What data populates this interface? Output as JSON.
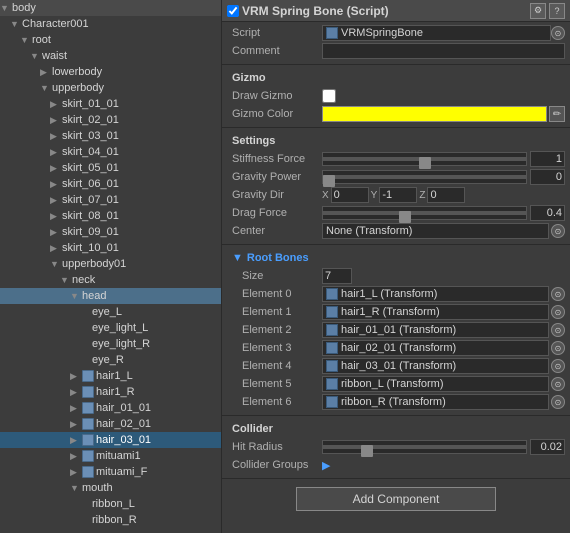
{
  "leftPanel": {
    "items": [
      {
        "id": "body",
        "label": "body",
        "indent": 0,
        "arrow": "down",
        "hasIcon": false
      },
      {
        "id": "character001",
        "label": "Character001",
        "indent": 1,
        "arrow": "down",
        "hasIcon": false
      },
      {
        "id": "root",
        "label": "root",
        "indent": 2,
        "arrow": "down",
        "hasIcon": false
      },
      {
        "id": "waist",
        "label": "waist",
        "indent": 3,
        "arrow": "down",
        "hasIcon": false
      },
      {
        "id": "lowerbody",
        "label": "lowerbody",
        "indent": 4,
        "arrow": "right",
        "hasIcon": false
      },
      {
        "id": "upperbody",
        "label": "upperbody",
        "indent": 4,
        "arrow": "down",
        "hasIcon": false
      },
      {
        "id": "skirt_01_01",
        "label": "skirt_01_01",
        "indent": 5,
        "arrow": "right",
        "hasIcon": false
      },
      {
        "id": "skirt_02_01",
        "label": "skirt_02_01",
        "indent": 5,
        "arrow": "right",
        "hasIcon": false
      },
      {
        "id": "skirt_03_01",
        "label": "skirt_03_01",
        "indent": 5,
        "arrow": "right",
        "hasIcon": false
      },
      {
        "id": "skirt_04_01",
        "label": "skirt_04_01",
        "indent": 5,
        "arrow": "right",
        "hasIcon": false
      },
      {
        "id": "skirt_05_01",
        "label": "skirt_05_01",
        "indent": 5,
        "arrow": "right",
        "hasIcon": false
      },
      {
        "id": "skirt_06_01",
        "label": "skirt_06_01",
        "indent": 5,
        "arrow": "right",
        "hasIcon": false
      },
      {
        "id": "skirt_07_01",
        "label": "skirt_07_01",
        "indent": 5,
        "arrow": "right",
        "hasIcon": false
      },
      {
        "id": "skirt_08_01",
        "label": "skirt_08_01",
        "indent": 5,
        "arrow": "right",
        "hasIcon": false
      },
      {
        "id": "skirt_09_01",
        "label": "skirt_09_01",
        "indent": 5,
        "arrow": "right",
        "hasIcon": false
      },
      {
        "id": "skirt_10_01",
        "label": "skirt_10_01",
        "indent": 5,
        "arrow": "right",
        "hasIcon": false
      },
      {
        "id": "upperbody01",
        "label": "upperbody01",
        "indent": 5,
        "arrow": "down",
        "hasIcon": false
      },
      {
        "id": "neck",
        "label": "neck",
        "indent": 6,
        "arrow": "down",
        "hasIcon": false
      },
      {
        "id": "head",
        "label": "head",
        "indent": 7,
        "arrow": "down",
        "hasIcon": false,
        "selected": true
      },
      {
        "id": "eye_L",
        "label": "eye_L",
        "indent": 8,
        "arrow": "empty",
        "hasIcon": false
      },
      {
        "id": "eye_light_L",
        "label": "eye_light_L",
        "indent": 8,
        "arrow": "empty",
        "hasIcon": false
      },
      {
        "id": "eye_light_R",
        "label": "eye_light_R",
        "indent": 8,
        "arrow": "empty",
        "hasIcon": false
      },
      {
        "id": "eye_R",
        "label": "eye_R",
        "indent": 8,
        "arrow": "empty",
        "hasIcon": false
      },
      {
        "id": "hair1_L",
        "label": "hair1_L",
        "indent": 7,
        "arrow": "right",
        "hasIcon": true
      },
      {
        "id": "hair1_R",
        "label": "hair1_R",
        "indent": 7,
        "arrow": "right",
        "hasIcon": true
      },
      {
        "id": "hair_01_01",
        "label": "hair_01_01",
        "indent": 7,
        "arrow": "right",
        "hasIcon": true
      },
      {
        "id": "hair_02_01",
        "label": "hair_02_01",
        "indent": 7,
        "arrow": "right",
        "hasIcon": true
      },
      {
        "id": "hair_03_01",
        "label": "hair_03_01",
        "indent": 7,
        "arrow": "right",
        "hasIcon": true,
        "selectedLight": true
      },
      {
        "id": "mituami1",
        "label": "mituami1",
        "indent": 7,
        "arrow": "right",
        "hasIcon": true
      },
      {
        "id": "mituami_F",
        "label": "mituami_F",
        "indent": 7,
        "arrow": "right",
        "hasIcon": true
      },
      {
        "id": "mouth",
        "label": "mouth",
        "indent": 7,
        "arrow": "down",
        "hasIcon": false
      },
      {
        "id": "ribbon_L",
        "label": "ribbon_L",
        "indent": 8,
        "arrow": "empty",
        "hasIcon": false
      },
      {
        "id": "ribbon_R",
        "label": "ribbon_R",
        "indent": 8,
        "arrow": "empty",
        "hasIcon": false
      }
    ]
  },
  "rightPanel": {
    "header": {
      "checkLabel": "✓",
      "title": "VRM Spring Bone (Script)",
      "settingsIcon": "⚙",
      "helpIcon": "?"
    },
    "scriptRow": {
      "label": "Script",
      "value": "VRMSpringBone"
    },
    "commentRow": {
      "label": "Comment",
      "value": ""
    },
    "gizmoSection": {
      "title": "Gizmo",
      "drawGizmoLabel": "Draw Gizmo",
      "gizmoColorLabel": "Gizmo Color"
    },
    "settingsSection": {
      "title": "Settings",
      "stiffnessForceLabel": "Stiffness Force",
      "stiffnessForceValue": "1",
      "gravityPowerLabel": "Gravity Power",
      "gravityPowerValue": "0",
      "gravityDirLabel": "Gravity Dir",
      "gravityDirX": "0",
      "gravityDirY": "-1",
      "gravityDirZ": "0",
      "dragForceLabel": "Drag Force",
      "dragForceValue": "0.4",
      "centerLabel": "Center",
      "centerValue": "None (Transform)"
    },
    "rootBones": {
      "title": "Root Bones",
      "arrowLabel": "▼",
      "sizeLabel": "Size",
      "sizeValue": "7",
      "elements": [
        {
          "index": 0,
          "label": "Element 0",
          "value": "hair1_L (Transform)"
        },
        {
          "index": 1,
          "label": "Element 1",
          "value": "hair1_R (Transform)"
        },
        {
          "index": 2,
          "label": "Element 2",
          "value": "hair_01_01 (Transform)"
        },
        {
          "index": 3,
          "label": "Element 3",
          "value": "hair_02_01 (Transform)"
        },
        {
          "index": 4,
          "label": "Element 4",
          "value": "hair_03_01 (Transform)"
        },
        {
          "index": 5,
          "label": "Element 5",
          "value": "ribbon_L (Transform)"
        },
        {
          "index": 6,
          "label": "Element 6",
          "value": "ribbon_R (Transform)"
        }
      ]
    },
    "colliderSection": {
      "title": "Collider",
      "hitRadiusLabel": "Hit Radius",
      "hitRadiusValue": "0.02",
      "colliderGroupsLabel": "Collider Groups"
    },
    "addComponentLabel": "Add Component"
  }
}
